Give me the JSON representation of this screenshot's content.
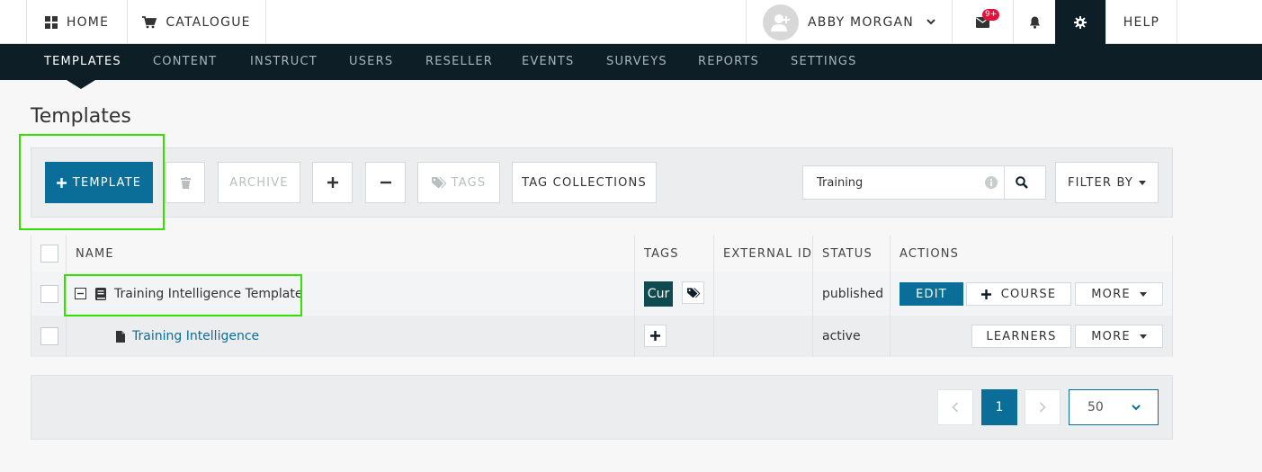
{
  "topbar": {
    "home_label": "HOME",
    "catalogue_label": "CATALOGUE",
    "user_name": "ABBY MORGAN",
    "mail_badge": "9+",
    "help_label": "HELP"
  },
  "nav": {
    "items": [
      "TEMPLATES",
      "CONTENT",
      "INSTRUCT",
      "USERS",
      "RESELLER",
      "EVENTS",
      "SURVEYS",
      "REPORTS",
      "SETTINGS"
    ],
    "active": "TEMPLATES"
  },
  "page": {
    "title": "Templates"
  },
  "toolbar": {
    "add_template_label": "TEMPLATE",
    "archive_label": "ARCHIVE",
    "tags_label": "TAGS",
    "tag_collections_label": "TAG COLLECTIONS",
    "search_value": "Training",
    "filter_label": "FILTER BY"
  },
  "table": {
    "headers": {
      "name": "NAME",
      "tags": "TAGS",
      "external_id": "EXTERNAL ID",
      "status": "STATUS",
      "actions": "ACTIONS"
    },
    "rows": [
      {
        "name": "Training Intelligence Template",
        "tag_chip": "Cur",
        "status": "published",
        "actions": {
          "edit": "EDIT",
          "course": "COURSE",
          "more": "MORE"
        }
      },
      {
        "name": "Training Intelligence",
        "status": "active",
        "actions": {
          "learners": "LEARNERS",
          "more": "MORE"
        }
      }
    ]
  },
  "pager": {
    "current_page": "1",
    "page_size": "50"
  },
  "colors": {
    "primary": "#0b6e99",
    "nav_bg": "#0d1e26",
    "highlight": "#33e000",
    "badge": "#e3123b"
  }
}
